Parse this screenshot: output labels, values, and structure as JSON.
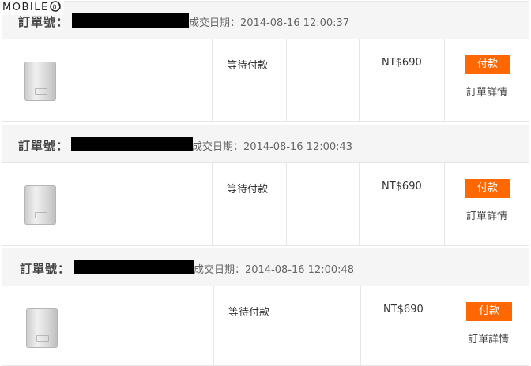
{
  "watermark": {
    "text": "MOBILE",
    "logo_icon": "mobile01-logo-icon"
  },
  "colors": {
    "pay_button": "#ff6700",
    "header_bg": "#f5f5f5",
    "border": "#e6e6e6",
    "id_mask": "#000000"
  },
  "orders": [
    {
      "order_label": "訂單號：",
      "order_id_mask_icon": "redacted-bar",
      "date_text": "成交日期：2014-08-16 12:00:37",
      "product_icon": "power-bank-image",
      "status": "等待付款",
      "price": "NT$690",
      "pay_label": "付款",
      "detail_label": "訂單詳情"
    },
    {
      "order_label": "訂單號：",
      "order_id_mask_icon": "redacted-bar",
      "date_text": "成交日期：2014-08-16 12:00:43",
      "product_icon": "power-bank-image",
      "status": "等待付款",
      "price": "NT$690",
      "pay_label": "付款",
      "detail_label": "訂單詳情"
    },
    {
      "order_label": "訂單號：",
      "order_id_mask_icon": "redacted-bar",
      "date_text": "成交日期：2014-08-16 12:00:48",
      "product_icon": "power-bank-image",
      "status": "等待付款",
      "price": "NT$690",
      "pay_label": "付款",
      "detail_label": "訂單詳情"
    }
  ]
}
